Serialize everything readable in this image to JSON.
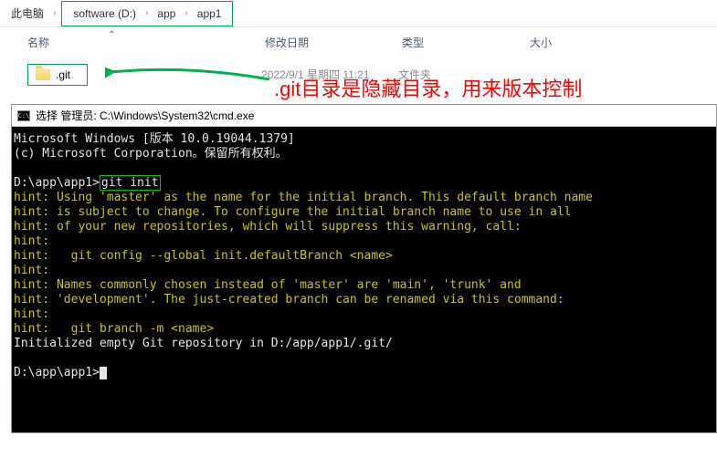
{
  "breadcrumb": {
    "root": "此电脑",
    "parts": [
      "software (D:)",
      "app",
      "app1"
    ]
  },
  "columns": {
    "name": "名称",
    "date": "修改日期",
    "type": "类型",
    "size": "大小"
  },
  "file": {
    "name": ".git",
    "date": "2022/9/1 星期四 11:21",
    "type": "文件夹"
  },
  "annotation": ".git目录是隐藏目录，用来版本控制",
  "terminal_title": "选择 管理员: C:\\Windows\\System32\\cmd.exe",
  "term": {
    "l1": "Microsoft Windows [版本 10.0.19044.1379]",
    "l2": "(c) Microsoft Corporation。保留所有权利。",
    "prompt1": "D:\\app\\app1>",
    "cmd": "git init",
    "h1": "hint: Using 'master' as the name for the initial branch. This default branch name",
    "h2": "hint: is subject to change. To configure the initial branch name to use in all",
    "h3": "hint: of your new repositories, which will suppress this warning, call:",
    "h4": "hint:",
    "h5": "hint:   git config --global init.defaultBranch <name>",
    "h6": "hint:",
    "h7": "hint: Names commonly chosen instead of 'master' are 'main', 'trunk' and",
    "h8": "hint: 'development'. The just-created branch can be renamed via this command:",
    "h9": "hint:",
    "h10": "hint:   git branch -m <name>",
    "init": "Initialized empty Git repository in D:/app/app1/.git/",
    "prompt2": "D:\\app\\app1>"
  }
}
